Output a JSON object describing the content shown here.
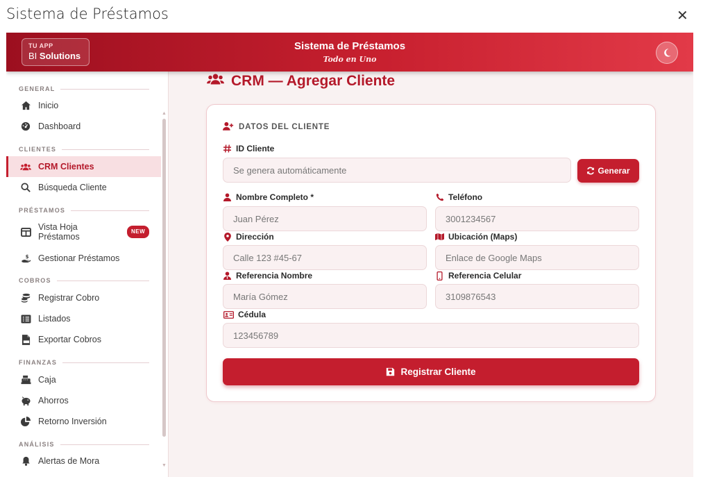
{
  "window": {
    "title": "Sistema de Préstamos",
    "close_glyph": "✕"
  },
  "brand": {
    "small": "TU APP",
    "prefix": "BI",
    "name": "Solutions"
  },
  "header": {
    "title": "Sistema de Préstamos",
    "subtitle": "Todo en Uno",
    "theme_icon": "moon-icon"
  },
  "sidebar": {
    "sections": {
      "general": "GENERAL",
      "clientes": "CLIENTES",
      "prestamos": "PRÉSTAMOS",
      "cobros": "COBROS",
      "finanzas": "FINANZAS",
      "analisis": "ANÁLISIS"
    },
    "items": {
      "inicio": "Inicio",
      "dashboard": "Dashboard",
      "crm": "CRM Clientes",
      "busqueda": "Búsqueda Cliente",
      "vista_hoja_1": "Vista Hoja",
      "vista_hoja_2": "Préstamos",
      "vista_badge": "NEW",
      "gestionar": "Gestionar Préstamos",
      "registrar_cobro": "Registrar Cobro",
      "listados": "Listados",
      "exportar": "Exportar Cobros",
      "caja": "Caja",
      "ahorros": "Ahorros",
      "retorno": "Retorno Inversión",
      "alertas": "Alertas de Mora"
    },
    "active": "CRM Clientes"
  },
  "page": {
    "title": "CRM — Agregar Cliente"
  },
  "form": {
    "section_title": "DATOS DEL CLIENTE",
    "id_label": "ID Cliente",
    "id_placeholder": "Se genera automáticamente",
    "generate_label": "Generar",
    "nombre_label": "Nombre Completo *",
    "nombre_placeholder": "Juan Pérez",
    "telefono_label": "Teléfono",
    "telefono_placeholder": "3001234567",
    "direccion_label": "Dirección",
    "direccion_placeholder": "Calle 123 #45-67",
    "ubicacion_label": "Ubicación (Maps)",
    "ubicacion_placeholder": "Enlace de Google Maps",
    "ref_nombre_label": "Referencia Nombre",
    "ref_nombre_placeholder": "María Gómez",
    "ref_celular_label": "Referencia Celular",
    "ref_celular_placeholder": "3109876543",
    "cedula_label": "Cédula",
    "cedula_placeholder": "123456789",
    "submit_label": "Registrar Cliente"
  },
  "colors": {
    "accent": "#c41e2e",
    "accent_dark": "#9c0f1f",
    "page_bg": "#f9f2f2"
  }
}
